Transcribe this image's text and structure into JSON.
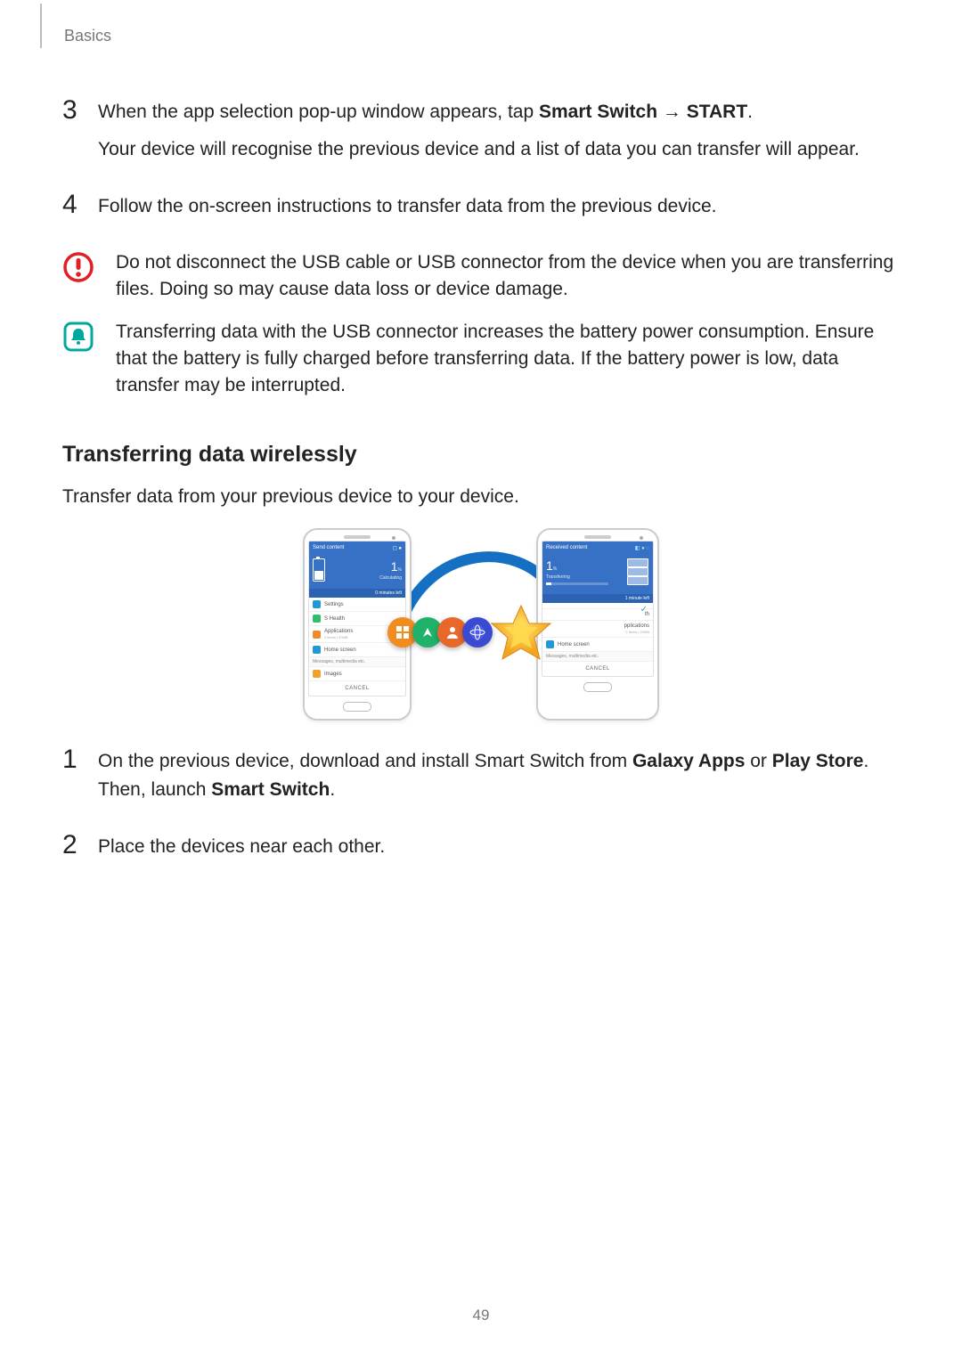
{
  "header": {
    "section": "Basics"
  },
  "page_number": "49",
  "step3": {
    "num": "3",
    "line1_pre": "When the app selection pop-up window appears, tap ",
    "line1_bold1": "Smart Switch",
    "line1_arrow": " → ",
    "line1_bold2": "START",
    "line1_post": ".",
    "line2": "Your device will recognise the previous device and a list of data you can transfer will appear."
  },
  "step4": {
    "num": "4",
    "text": "Follow the on-screen instructions to transfer data from the previous device."
  },
  "warn": {
    "text": "Do not disconnect the USB cable or USB connector from the device when you are transferring files. Doing so may cause data loss or device damage."
  },
  "note": {
    "text": "Transferring data with the USB connector increases the battery power consumption. Ensure that the battery is fully charged before transferring data. If the battery power is low, data transfer may be interrupted."
  },
  "sub_heading": "Transferring data wirelessly",
  "sub_intro": "Transfer data from your previous device to your device.",
  "step_w1": {
    "num": "1",
    "pre": "On the previous device, download and install Smart Switch from ",
    "b1": "Galaxy Apps",
    "mid1": " or ",
    "b2": "Play Store",
    "mid2": ". Then, launch ",
    "b3": "Smart Switch",
    "post": "."
  },
  "step_w2": {
    "num": "2",
    "text": "Place the devices near each other."
  },
  "figure": {
    "left_phone": {
      "topbar_left": "Send content",
      "percent": "1",
      "percent_unit": "%",
      "status": "Calculating",
      "estimate": "0 minutes left",
      "rows": [
        {
          "label": "Settings",
          "color": "#1f9ad6"
        },
        {
          "label": "S Health",
          "color": "#2fbf6b"
        },
        {
          "label": "Applications",
          "sub": "2 items | 20MB",
          "color": "#ef8b2c"
        },
        {
          "label": "Home screen",
          "color": "#1f9ad6"
        }
      ],
      "section": "Messages, multimedia etc.",
      "images_row": {
        "label": "Images",
        "color": "#f0a32c"
      },
      "cancel": "CANCEL"
    },
    "right_phone": {
      "topbar_left": "Received content",
      "percent": "1",
      "percent_unit": "%",
      "status": "Transferring",
      "estimate": "1 minute left",
      "rows_partially_hidden": [
        {
          "label": "th",
          "color": "#2fbf6b"
        },
        {
          "label": "pplications",
          "sub": "2 items | 20MB",
          "color": "#ef8b2c"
        },
        {
          "label": "Home screen",
          "color": "#1f9ad6"
        }
      ],
      "section": "Messages, multimedia etc.",
      "cancel": "CANCEL"
    },
    "icon_names": [
      "grid-icon",
      "compass-icon",
      "contact-icon",
      "globe-icon",
      "star-icon"
    ]
  }
}
